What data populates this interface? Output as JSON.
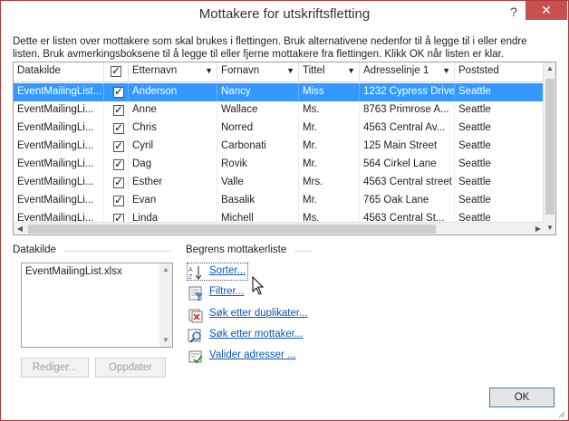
{
  "window": {
    "title": "Mottakere for utskriftsfletting",
    "help_glyph": "?",
    "close_glyph": "✕"
  },
  "intro": "Dette er listen over mottakere som skal brukes i flettingen. Bruk alternativene nedenfor til å legge til i eller endre listen. Bruk avmerkingsboksene til å legge til eller fjerne mottakere fra flettingen. Klikk OK når listen er klar.",
  "grid": {
    "columns": [
      "Datakilde",
      "",
      "Etternavn",
      "Fornavn",
      "Tittel",
      "Adresselinje 1",
      "Poststed"
    ],
    "rows": [
      {
        "source": "EventMailingList...",
        "checked": true,
        "last": "Anderson",
        "first": "Nancy",
        "title": "Miss",
        "address": "1232 Cypress Drive",
        "city": "Seattle"
      },
      {
        "source": "EventMailingLi...",
        "checked": true,
        "last": "Anne",
        "first": "Wallace",
        "title": "Ms.",
        "address": "8763 Primrose A...",
        "city": "Seattle"
      },
      {
        "source": "EventMailingLi...",
        "checked": true,
        "last": "Chris",
        "first": "Norred",
        "title": "Mr.",
        "address": "4563 Central Av...",
        "city": "Seattle"
      },
      {
        "source": "EventMailingLi...",
        "checked": true,
        "last": "Cyril",
        "first": "Carbonati",
        "title": "Mr.",
        "address": "125 Main Street",
        "city": "Seattle"
      },
      {
        "source": "EventMailingLi...",
        "checked": true,
        "last": "Dag",
        "first": "Rovik",
        "title": "Mr.",
        "address": "564 Cirkel Lane",
        "city": "Seattle"
      },
      {
        "source": "EventMailingLi...",
        "checked": true,
        "last": "Esther",
        "first": "Valle",
        "title": "Mrs.",
        "address": "4563 Central street",
        "city": "Seattle"
      },
      {
        "source": "EventMailingLi...",
        "checked": true,
        "last": "Evan",
        "first": "Basalik",
        "title": "Mr.",
        "address": "765 Oak Lane",
        "city": "Seattle"
      },
      {
        "source": "EventMailingLi...",
        "checked": true,
        "last": "Linda",
        "first": "Michell",
        "title": "Ms.",
        "address": "4563 Central St...",
        "city": "Seattle"
      }
    ]
  },
  "datasource_group": {
    "label": "Datakilde",
    "items": [
      "EventMailingList.xlsx"
    ],
    "edit_button": "Rediger...",
    "refresh_button": "Oppdater"
  },
  "refine_group": {
    "label": "Begrens mottakerliste",
    "links": [
      {
        "label": "Sorter...",
        "icon": "sort-icon"
      },
      {
        "label": "Filtrer...",
        "icon": "filter-icon"
      },
      {
        "label": "Søk etter duplikater...",
        "icon": "duplicates-icon"
      },
      {
        "label": "Søk etter mottaker...",
        "icon": "find-recipient-icon"
      },
      {
        "label": "Valider adresser ...",
        "icon": "validate-icon"
      }
    ]
  },
  "ok_button": "OK",
  "colors": {
    "selection": "#3399ff",
    "link": "#0b57b8",
    "close": "#c75050"
  }
}
